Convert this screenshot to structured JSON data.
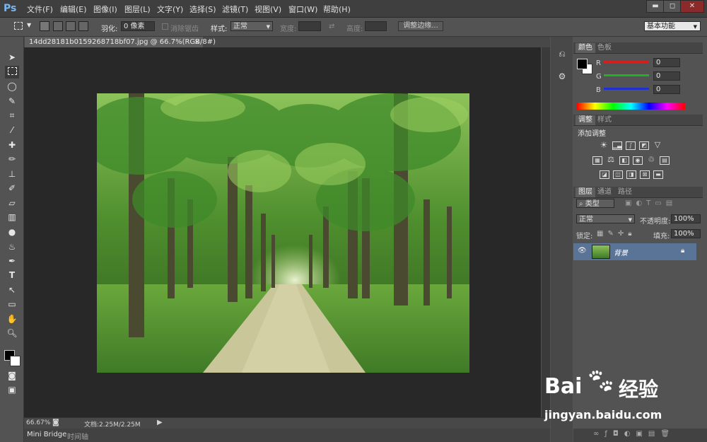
{
  "app": {
    "logo": "Ps"
  },
  "menu": [
    "文件(F)",
    "编辑(E)",
    "图像(I)",
    "图层(L)",
    "文字(Y)",
    "选择(S)",
    "滤镜(T)",
    "视图(V)",
    "窗口(W)",
    "帮助(H)"
  ],
  "window_buttons": {
    "minimize": "▬",
    "maximize": "◻",
    "close": "✕"
  },
  "options": {
    "feather_label": "羽化:",
    "feather_value": "0 像素",
    "antialias_label": "消除锯齿",
    "style_label": "样式:",
    "style_value": "正常",
    "width_label": "宽度:",
    "height_label": "高度:",
    "refine_edge": "调整边缘...",
    "workspace": "基本功能"
  },
  "document": {
    "tab_title": "14dd28181b0159268718bf07.jpg @ 66.7%(RGB/8#)",
    "zoom": "66.67%",
    "doc_size": "文档:2.25M/2.25M"
  },
  "bottom_tabs": [
    "Mini Bridge",
    "时间轴"
  ],
  "color_panel": {
    "tabs": [
      "颜色",
      "色板"
    ],
    "channels": [
      {
        "label": "R",
        "value": "0",
        "color": "#d02020"
      },
      {
        "label": "G",
        "value": "0",
        "color": "#20b020"
      },
      {
        "label": "B",
        "value": "0",
        "color": "#2030d0"
      }
    ]
  },
  "adjust_panel": {
    "tabs": [
      "调整",
      "样式"
    ],
    "title": "添加调整"
  },
  "layers_panel": {
    "tabs": [
      "图层",
      "通道",
      "路径"
    ],
    "filter_label": "类型",
    "blend_mode": "正常",
    "opacity_label": "不透明度:",
    "opacity_value": "100%",
    "lock_label": "锁定:",
    "fill_label": "填充:",
    "fill_value": "100%",
    "layer_name": "背景"
  },
  "watermark": {
    "brand": "Bai",
    "brand2": "经验",
    "url": "jingyan.baidu.com"
  }
}
